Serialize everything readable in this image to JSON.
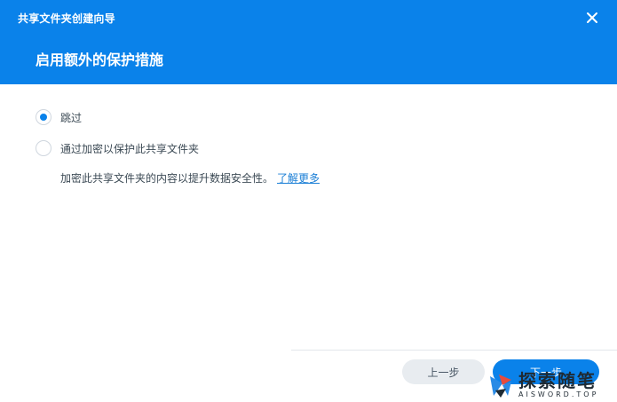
{
  "window": {
    "title": "共享文件夹创建向导",
    "step_title": "启用额外的保护措施"
  },
  "options": [
    {
      "label": "跳过",
      "checked": true
    },
    {
      "label": "通过加密以保护此共享文件夹",
      "checked": false
    }
  ],
  "description": {
    "text": "加密此共享文件夹的内容以提升数据安全性。",
    "link_label": "了解更多"
  },
  "footer": {
    "prev_label": "上一步",
    "next_label": "下一步"
  },
  "watermark": {
    "cn": "探索随笔",
    "en": "AISWORD.TOP"
  },
  "colors": {
    "accent": "#0a82ea",
    "link": "#1b7fd6",
    "text": "#3c4a55"
  },
  "icons": {
    "close": "close-icon"
  }
}
